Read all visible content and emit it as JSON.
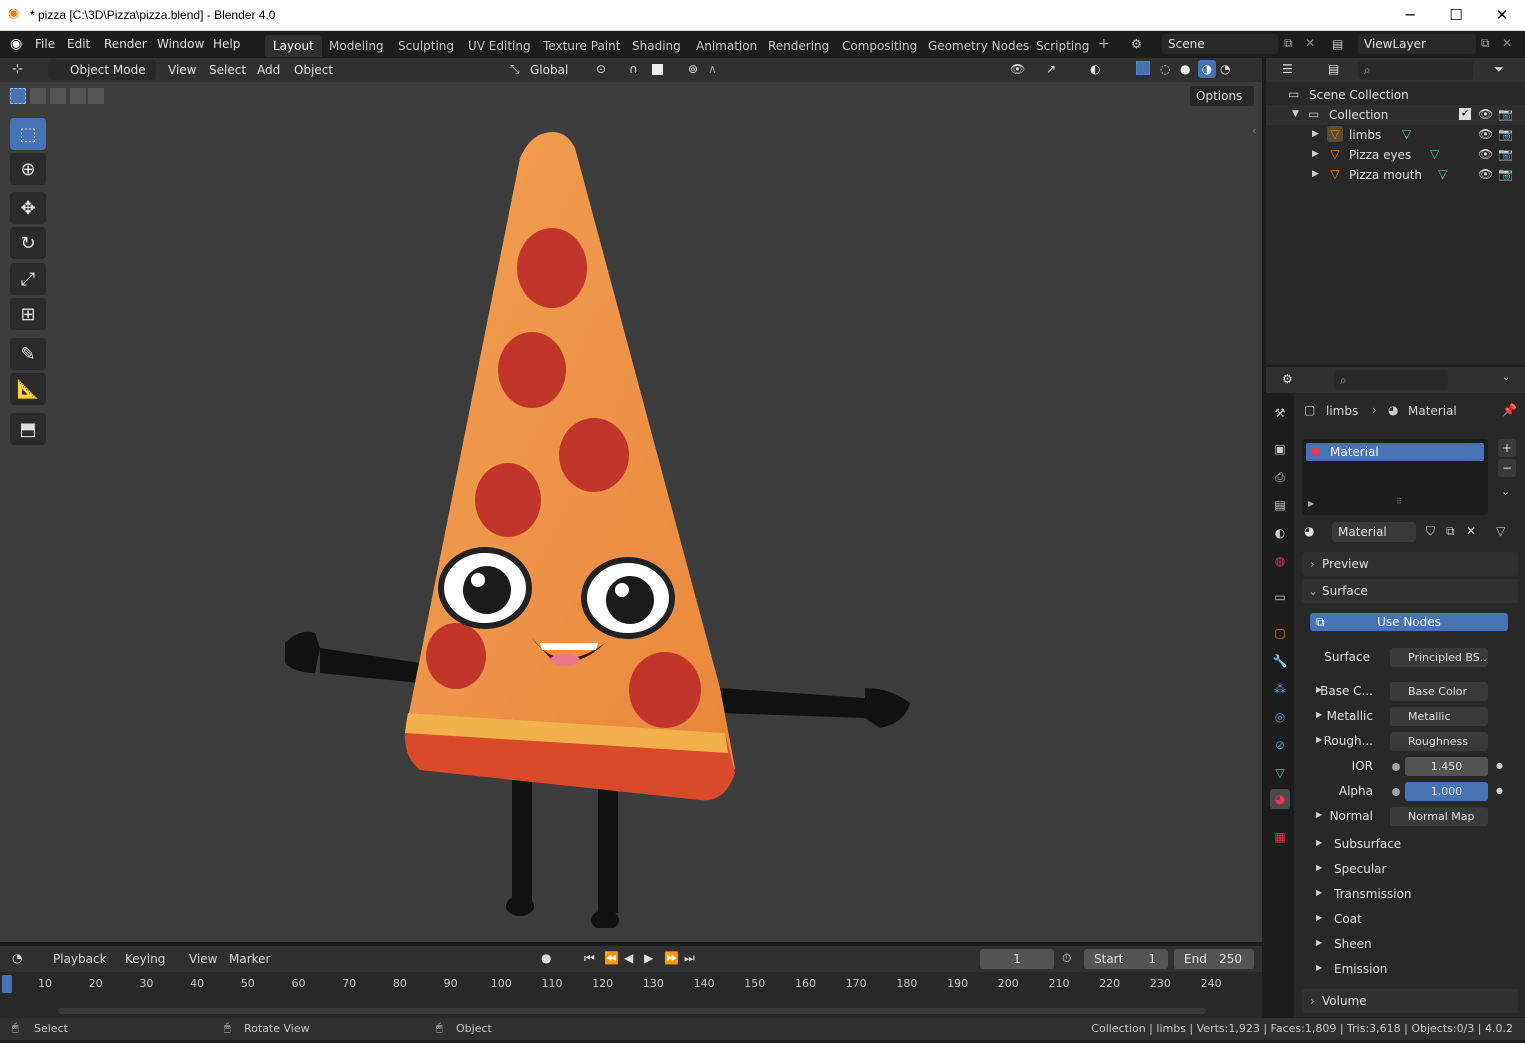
{
  "window": {
    "title": "* pizza [C:\\3D\\Pizza\\pizza.blend] - Blender 4.0"
  },
  "menu": [
    "File",
    "Edit",
    "Render",
    "Window",
    "Help"
  ],
  "workspaces": [
    "Layout",
    "Modeling",
    "Sculpting",
    "UV Editing",
    "Texture Paint",
    "Shading",
    "Animation",
    "Rendering",
    "Compositing",
    "Geometry Nodes",
    "Scripting"
  ],
  "scene": "Scene",
  "view_layer": "ViewLayer",
  "viewport": {
    "mode": "Object Mode",
    "menus": [
      "View",
      "Select",
      "Add",
      "Object"
    ],
    "transform_orientation": "Global",
    "options_label": "Options"
  },
  "outliner": {
    "root": "Scene Collection",
    "collection": "Collection",
    "objects": [
      "limbs",
      "Pizza eyes",
      "Pizza mouth"
    ]
  },
  "properties": {
    "breadcrumb_object": "limbs",
    "breadcrumb_data": "Material",
    "slot_name": "Material",
    "material_name": "Material",
    "panels": {
      "preview": "Preview",
      "surface": "Surface",
      "volume": "Volume"
    },
    "use_nodes_label": "Use Nodes",
    "surface_label": "Surface",
    "surface_value": "Principled BS...",
    "inputs": [
      {
        "label": "Base C...",
        "value": "Base Color",
        "dot": "#c7c729"
      },
      {
        "label": "Metallic",
        "value": "Metallic",
        "dot": "#a1a1a1"
      },
      {
        "label": "Rough...",
        "value": "Roughness",
        "dot": "#a1a1a1"
      },
      {
        "label": "IOR",
        "value": "1.450",
        "dot": "#a1a1a1"
      },
      {
        "label": "Alpha",
        "value": "1.000",
        "dot": "#a1a1a1"
      },
      {
        "label": "Normal",
        "value": "Normal Map",
        "dot": "#6363c7"
      }
    ],
    "subpanels": [
      "Subsurface",
      "Specular",
      "Transmission",
      "Coat",
      "Sheen",
      "Emission"
    ]
  },
  "timeline": {
    "menus": [
      "Playback",
      "Keying",
      "View",
      "Marker"
    ],
    "current_frame": "1",
    "start_label": "Start",
    "start": "1",
    "end_label": "End",
    "end": "250",
    "ticks": [
      "10",
      "20",
      "30",
      "40",
      "50",
      "60",
      "70",
      "80",
      "90",
      "100",
      "110",
      "120",
      "130",
      "140",
      "150",
      "160",
      "170",
      "180",
      "190",
      "200",
      "210",
      "220",
      "230",
      "240"
    ]
  },
  "status": {
    "left_select": "Select",
    "rotate_view": "Rotate View",
    "object": "Object",
    "stats": "Collection | limbs | Verts:1,923 | Faces:1,809 | Tris:3,618 | Objects:0/3 | 4.0.2"
  }
}
